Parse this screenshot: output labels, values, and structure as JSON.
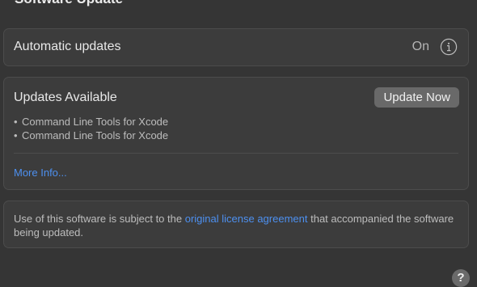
{
  "header": {
    "title": "Software Update"
  },
  "automatic_updates": {
    "label": "Automatic updates",
    "value": "On",
    "info_icon": "info-circle-icon"
  },
  "updates": {
    "title": "Updates Available",
    "button_label": "Update Now",
    "bullet": "•",
    "items": [
      {
        "label": "Command Line Tools for Xcode"
      },
      {
        "label": "Command Line Tools for Xcode"
      }
    ],
    "more_info_label": "More Info..."
  },
  "license": {
    "text_before": "Use of this software is subject to the ",
    "link_label": "original license agreement",
    "text_after": " that accompanied the software being updated."
  },
  "help": {
    "label": "?",
    "icon": "question-mark-icon"
  },
  "colors": {
    "background": "#353535",
    "panel": "#3c3c3c",
    "panel_border": "#4c4c4c",
    "link": "#4d90f0",
    "button": "#696969"
  }
}
